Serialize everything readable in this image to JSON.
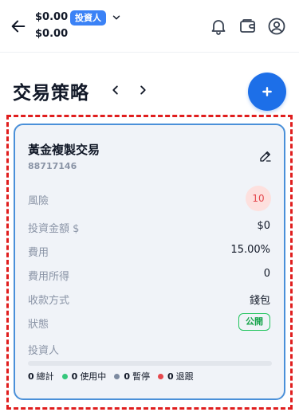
{
  "header": {
    "balance_primary": "$0.00",
    "balance_secondary": "$0.00",
    "account_type": "投資人",
    "icons": [
      "arrow-left-icon",
      "chevron-down-icon",
      "bell-icon",
      "wallet-icon",
      "user-circle-icon"
    ]
  },
  "page": {
    "title": "交易策略",
    "nav_icons": [
      "chevron-left-icon",
      "chevron-right-icon"
    ],
    "add_icon": "plus-icon"
  },
  "strategy": {
    "name": "黃金複製交易",
    "id": "88717146",
    "edit_icon": "pencil-icon",
    "rows": {
      "risk": {
        "label": "風險",
        "value": "10"
      },
      "investment": {
        "label": "投資金額 $",
        "value": "$0"
      },
      "fee": {
        "label": "費用",
        "value": "15.00%"
      },
      "fee_income": {
        "label": "費用所得",
        "value": "0"
      },
      "payment": {
        "label": "收款方式",
        "value": "錢包"
      },
      "status": {
        "label": "狀態",
        "value": "公開"
      },
      "investors": {
        "label": "投資人"
      }
    },
    "progress": {
      "fraction": 0
    },
    "stats": [
      {
        "count": "0",
        "label": "總計",
        "color": ""
      },
      {
        "count": "0",
        "label": "使用中",
        "color": "#34c77b"
      },
      {
        "count": "0",
        "label": "暫停",
        "color": "#7c8aa0"
      },
      {
        "count": "0",
        "label": "退跟",
        "color": "#e5484d"
      }
    ]
  },
  "colors": {
    "accent": "#1d6fe8",
    "card_border": "#4a90d9",
    "selection_outline": "#e01e1e",
    "risk": "#e5484d",
    "public": "#16a34a"
  }
}
